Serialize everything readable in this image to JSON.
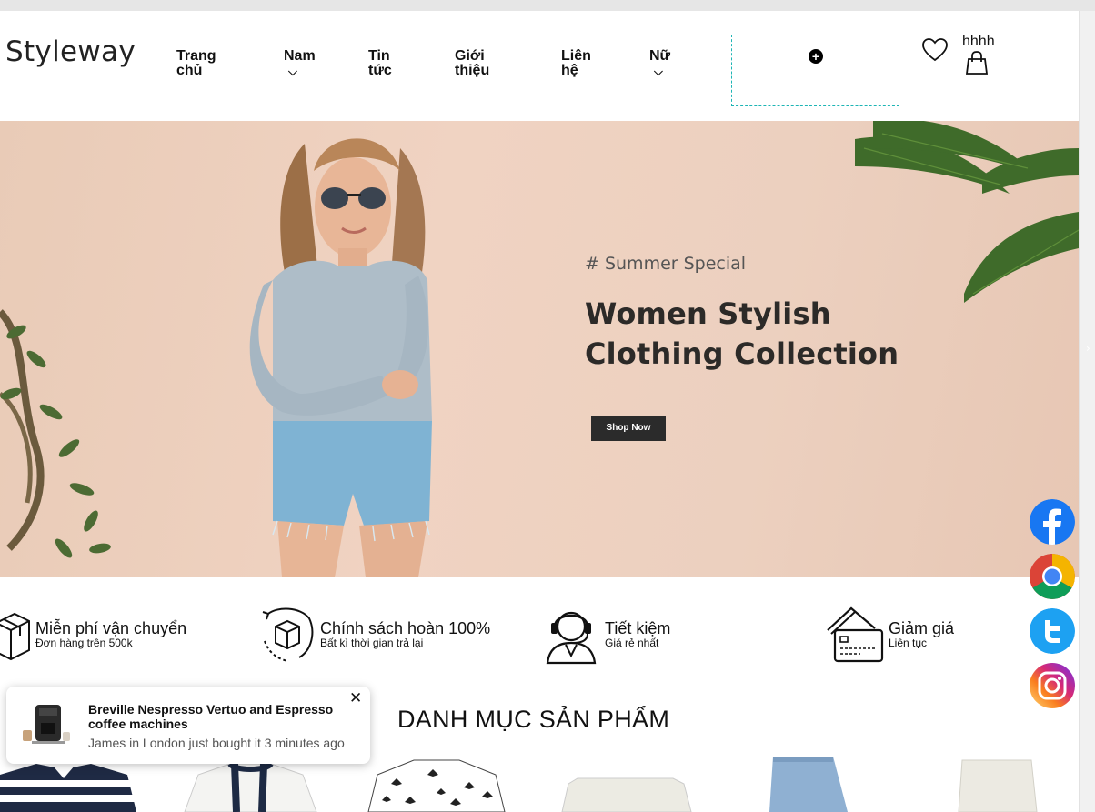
{
  "header": {
    "brand": "Styleway",
    "nav": [
      {
        "label": "Trang chủ"
      },
      {
        "label": "Nam",
        "dropdown": true
      },
      {
        "label": "Tin tức"
      },
      {
        "label": "Giới thiệu"
      },
      {
        "label": "Liên hệ"
      },
      {
        "label": "Nữ",
        "dropdown": true
      }
    ],
    "user_label": "hhhh",
    "icons": [
      "add-circle-icon",
      "heart-icon",
      "shopping-bag-icon"
    ]
  },
  "hero": {
    "tag": "# Summer Special",
    "headline_line1": "Women Stylish",
    "headline_line2": "Clothing Collection",
    "button": "Shop Now"
  },
  "features": [
    {
      "title": "Miễn phí vận chuyển",
      "subtitle": "Đơn hàng trên 500k",
      "icon": "box-icon"
    },
    {
      "title": "Chính sách hoàn 100%",
      "subtitle": "Bất kì thời gian trả lại",
      "icon": "return-box-icon"
    },
    {
      "title": "Tiết kiệm",
      "subtitle": "Giá rẻ nhất",
      "icon": "support-agent-icon"
    },
    {
      "title": "Giảm giá",
      "subtitle": "Liên tục",
      "icon": "credit-card-icon"
    }
  ],
  "popup": {
    "title": "Breville Nespresso Vertuo and Espresso coffee machines",
    "subtitle": "James in London just bought it 3 minutes ago",
    "close": "✕"
  },
  "section_title": "DANH MỤC SẢN PHẨM",
  "social": [
    "facebook-icon",
    "chrome-icon",
    "twitter-icon",
    "instagram-icon"
  ],
  "colors": {
    "accent_border": "#1db5b5",
    "facebook": "#1877f2",
    "twitter": "#1da1f2",
    "button": "#2b2b2b"
  }
}
